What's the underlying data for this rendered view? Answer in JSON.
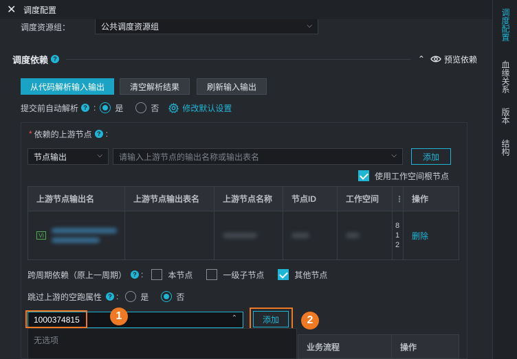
{
  "window": {
    "title": "调度配置",
    "close_glyph": "✕"
  },
  "right_nav": {
    "items": [
      "调度配置",
      "血缘关系",
      "版本",
      "结构"
    ],
    "active_index": 0
  },
  "resource_group": {
    "label": "调度资源组：",
    "value": "公共调度资源组"
  },
  "dependency": {
    "title": "调度依赖",
    "preview_label": "预览依赖",
    "buttons": {
      "parse": "从代码解析输入输出",
      "clear": "清空解析结果",
      "refresh": "刷新输入输出"
    },
    "auto_parse": {
      "label": "提交前自动解析",
      "yes": "是",
      "no": "否",
      "selected": "是",
      "modify_default": "修改默认设置"
    },
    "upstream": {
      "label": "依赖的上游节点",
      "required_mark": "*",
      "type_select": "节点输出",
      "search_placeholder": "请输入上游节点的输出名称或输出表名",
      "add_label": "添加",
      "use_root_label": "使用工作空间根节点",
      "use_root_checked": true
    },
    "table": {
      "columns": [
        "上游节点输出名",
        "上游节点输出表名",
        "上游节点名称",
        "节点ID",
        "工作空间",
        "操作"
      ],
      "row": {
        "tag": "Vi",
        "action": "删除",
        "owner_stub": [
          "8",
          "1",
          "2"
        ]
      }
    },
    "cross_cycle": {
      "label": "跨周期依赖（原上一周期）",
      "options": [
        {
          "label": "本节点",
          "checked": false
        },
        {
          "label": "一级子节点",
          "checked": false
        },
        {
          "label": "其他节点",
          "checked": true
        }
      ]
    },
    "skip_dry_run": {
      "label": "跳过上游的空跑属性",
      "yes": "是",
      "no": "否",
      "selected": "否"
    },
    "other_nodes": {
      "input_value": "1000374815",
      "add_label": "添加",
      "no_options": "无选项",
      "columns": [
        "业务流程",
        "操作"
      ]
    }
  },
  "annotations": {
    "step1": "1",
    "step2": "2"
  },
  "colors": {
    "accent": "#1fb6d6",
    "highlight": "#f07a24",
    "background": "#25282d"
  }
}
